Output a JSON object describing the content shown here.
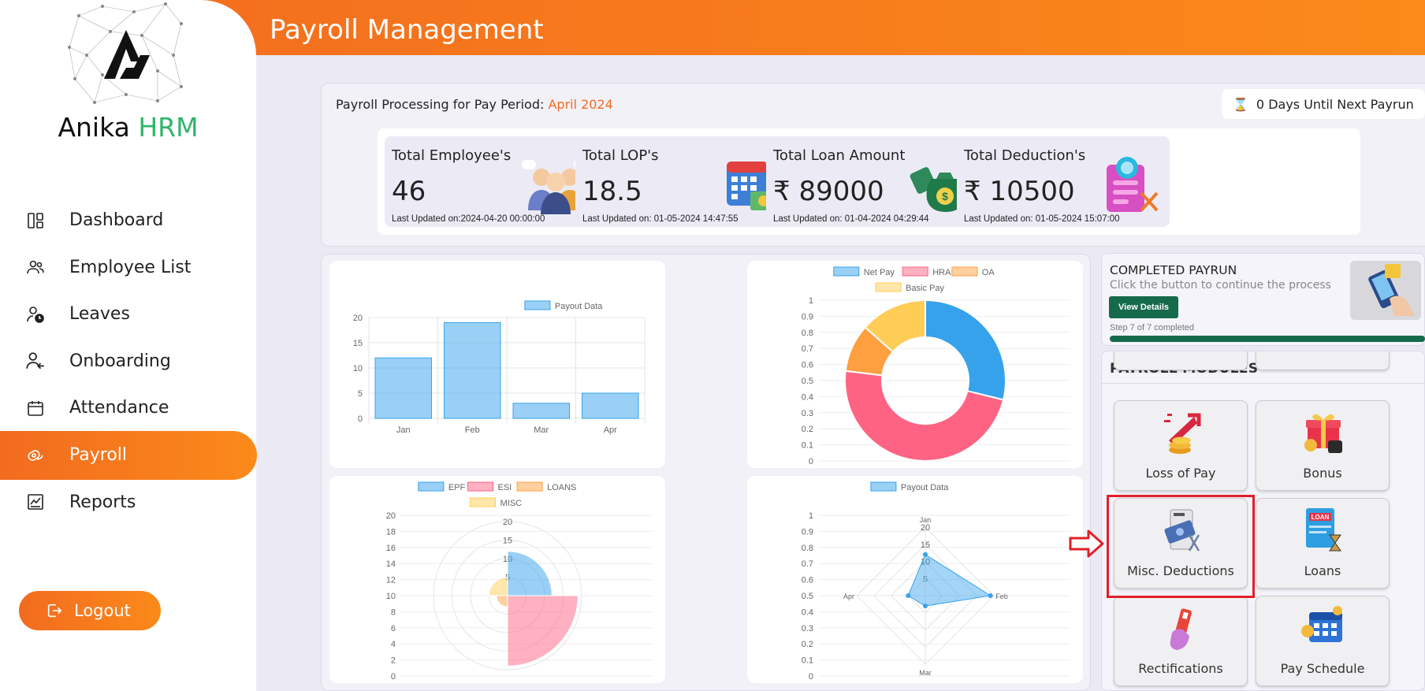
{
  "app": {
    "brand_part1": "Anika ",
    "brand_part2": "HRM",
    "page_title": "Payroll Management"
  },
  "sidebar": {
    "items": [
      {
        "label": "Dashboard",
        "icon": "dashboard-icon"
      },
      {
        "label": "Employee List",
        "icon": "users-icon"
      },
      {
        "label": "Leaves",
        "icon": "leave-clock-icon"
      },
      {
        "label": "Onboarding",
        "icon": "user-arrow-icon"
      },
      {
        "label": "Attendance",
        "icon": "calendar-icon"
      },
      {
        "label": "Payroll",
        "icon": "payroll-icon",
        "active": true
      },
      {
        "label": "Reports",
        "icon": "reports-chart-icon"
      }
    ],
    "logout": "Logout"
  },
  "pay_period": {
    "label": "Payroll Processing for Pay Period: ",
    "value": "April 2024"
  },
  "next_payrun": "0 Days Until Next Payrun",
  "stats": [
    {
      "title": "Total Employee's",
      "value": "46",
      "updated": "Last Updated on:2024-04-20 00:00:00",
      "icon": "employees-icon"
    },
    {
      "title": "Total LOP's",
      "value": "18.5",
      "updated": "Last Updated on: 01-05-2024 14:47:55",
      "icon": "calendar-money-icon"
    },
    {
      "title": "Total Loan Amount",
      "value": "₹ 89000",
      "updated": "Last Updated on: 01-04-2024 04:29:44",
      "icon": "money-bag-icon"
    },
    {
      "title": "Total Deduction's",
      "value": "₹ 10500",
      "updated": "Last Updated on: 01-05-2024 15:07:00",
      "icon": "deduction-document-icon"
    }
  ],
  "completed_payrun": {
    "title": "COMPLETED PAYRUN",
    "subtitle": "Click the button to continue the process",
    "button": "View Details",
    "step": "Step 7 of 7 completed",
    "progress": 1.0
  },
  "payroll_modules": {
    "title": "PAYROLL MODULES",
    "tiles": [
      {
        "label": "Loss of Pay",
        "icon": "loss-of-pay-icon"
      },
      {
        "label": "Bonus",
        "icon": "bonus-gift-icon"
      },
      {
        "label": "Misc. Deductions",
        "icon": "misc-deductions-icon",
        "highlighted": true
      },
      {
        "label": "Loans",
        "icon": "loans-icon"
      },
      {
        "label": "Rectifications",
        "icon": "rectifications-icon"
      },
      {
        "label": "Pay Schedule",
        "icon": "pay-schedule-icon"
      }
    ]
  },
  "colors": {
    "accent": "#f26b1f",
    "brand_green": "#2fb56a",
    "button_green": "#166a4c",
    "highlight_red": "#e0202a"
  },
  "chart_data": [
    {
      "type": "bar",
      "legend": [
        "Payout Data"
      ],
      "categories": [
        "Jan",
        "Feb",
        "Mar",
        "Apr"
      ],
      "values": [
        12,
        19,
        3,
        5
      ],
      "ylim": [
        0,
        20
      ],
      "yticks": [
        0,
        5,
        10,
        15,
        20
      ]
    },
    {
      "type": "pie",
      "variant": "doughnut",
      "legend": [
        "Net Pay",
        "HRA",
        "OA",
        "Basic Pay"
      ],
      "values": [
        30,
        50,
        10,
        14
      ],
      "colors": [
        "#36a2eb",
        "#ff6384",
        "#ff9f40",
        "#ffcd56"
      ],
      "yticks": [
        0,
        0.1,
        0.2,
        0.3,
        0.4,
        0.5,
        0.6,
        0.7,
        0.8,
        0.9,
        1
      ]
    },
    {
      "type": "polar",
      "legend": [
        "EPF",
        "ESI",
        "LOANS",
        "MISC"
      ],
      "values": [
        12,
        19,
        3,
        5
      ],
      "colors": [
        "#36a2eb",
        "#ff6384",
        "#ff9f40",
        "#ffcd56"
      ],
      "rticks": [
        5,
        10,
        15,
        20
      ],
      "yticks": [
        0,
        2,
        4,
        6,
        8,
        10,
        12,
        14,
        16,
        18,
        20
      ]
    },
    {
      "type": "radar",
      "legend": [
        "Payout Data"
      ],
      "categories": [
        "Jan",
        "Feb",
        "Mar",
        "Apr"
      ],
      "values": [
        12,
        19,
        3,
        5
      ],
      "rticks": [
        5,
        10,
        15,
        20
      ],
      "yticks": [
        0,
        0.1,
        0.2,
        0.3,
        0.4,
        0.5,
        0.6,
        0.7,
        0.8,
        0.9,
        1
      ]
    }
  ]
}
